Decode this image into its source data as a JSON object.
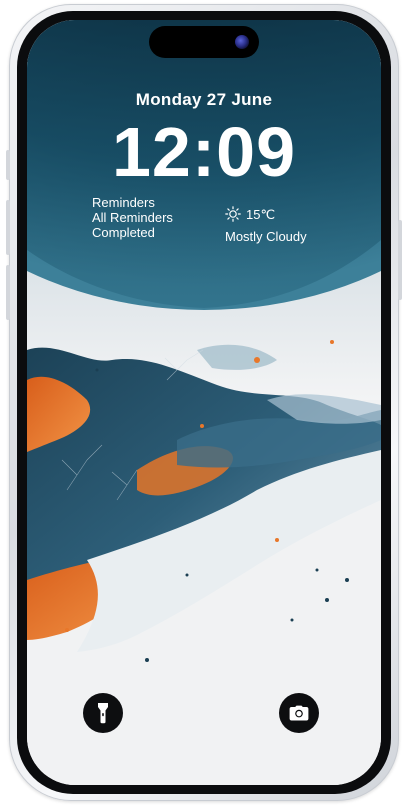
{
  "lockscreen": {
    "date": "Monday 27 June",
    "time": "12:09"
  },
  "reminders_widget": {
    "line1": "Reminders",
    "line2": "All Reminders",
    "line3": "Completed"
  },
  "weather_widget": {
    "temperature": "15℃",
    "condition": "Mostly Cloudy",
    "icon": "sun-icon"
  },
  "bottom_controls": {
    "left_icon": "flashlight-icon",
    "right_icon": "camera-icon"
  },
  "colors": {
    "sky_dark": "#0f3448",
    "sky_mid": "#1d5b73",
    "accent_orange": "#e8772a",
    "frame": "#dcdfe3"
  }
}
